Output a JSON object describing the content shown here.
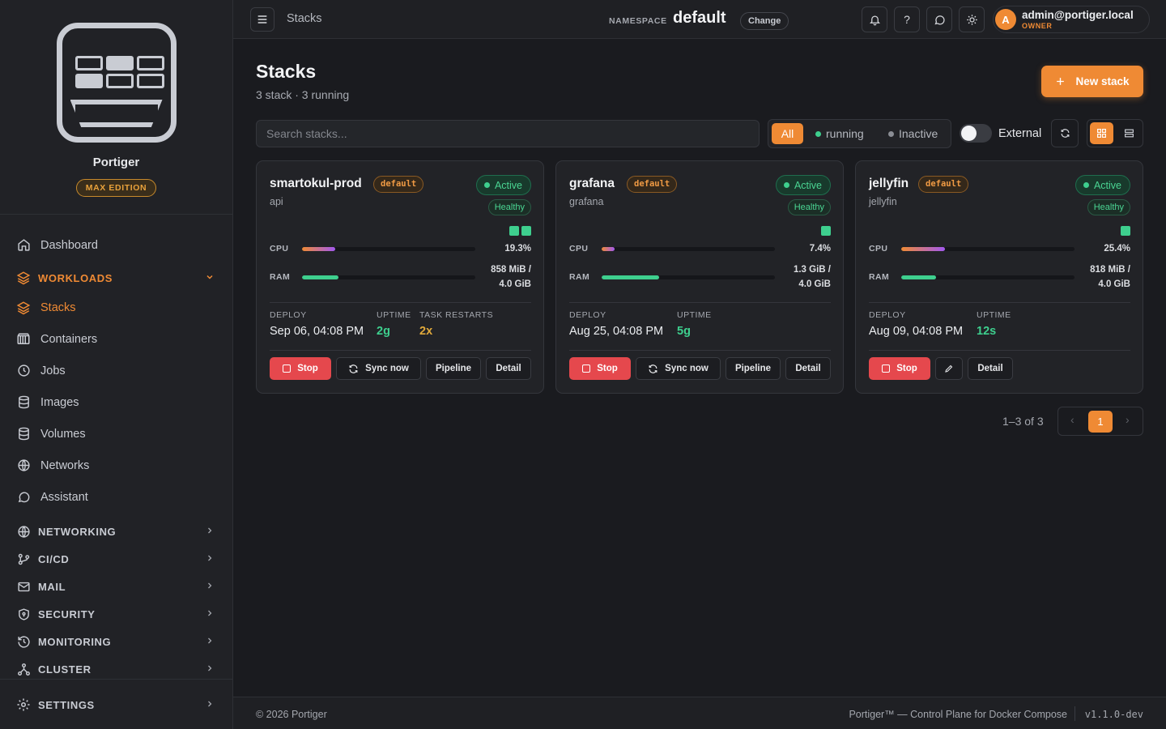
{
  "sidebar": {
    "brand_name": "Portiger",
    "edition": "MAX EDITION",
    "items_top": [
      {
        "label": "Dashboard",
        "icon": "home-icon"
      }
    ],
    "workloads_label": "WORKLOADS",
    "workloads_items": [
      {
        "label": "Stacks",
        "icon": "layers-icon",
        "active": true
      },
      {
        "label": "Containers",
        "icon": "container-icon"
      },
      {
        "label": "Jobs",
        "icon": "clock-icon"
      },
      {
        "label": "Images",
        "icon": "database-icon"
      },
      {
        "label": "Volumes",
        "icon": "database-icon"
      },
      {
        "label": "Networks",
        "icon": "globe-icon"
      },
      {
        "label": "Assistant",
        "icon": "chat-icon"
      }
    ],
    "groups": [
      {
        "label": "NETWORKING",
        "icon": "globe-icon"
      },
      {
        "label": "CI/CD",
        "icon": "git-icon"
      },
      {
        "label": "MAIL",
        "icon": "mail-icon"
      },
      {
        "label": "SECURITY",
        "icon": "shield-icon"
      },
      {
        "label": "MONITORING",
        "icon": "history-icon"
      },
      {
        "label": "CLUSTER",
        "icon": "cluster-icon"
      }
    ],
    "settings_label": "SETTINGS"
  },
  "topbar": {
    "breadcrumb": "Stacks",
    "namespace_label": "NAMESPACE",
    "namespace_value": "default",
    "namespace_change": "Change",
    "help_glyph": "?",
    "user_initial": "A",
    "user_email": "admin@portiger.local",
    "user_role": "OWNER"
  },
  "main": {
    "title": "Stacks",
    "subtitle": "3 stack · 3 running",
    "new_stack_label": "New stack",
    "search_placeholder": "Search stacks...",
    "filters": {
      "all": "All",
      "running": "running",
      "inactive": "Inactive"
    },
    "external_label": "External"
  },
  "labels": {
    "cpu": "CPU",
    "ram": "RAM",
    "deploy": "DEPLOY",
    "uptime": "UPTIME",
    "task_restarts": "TASK RESTARTS",
    "stop": "Stop",
    "sync": "Sync now",
    "pipeline": "Pipeline",
    "detail": "Detail"
  },
  "stacks": [
    {
      "name": "smartokul-prod",
      "namespace": "default",
      "service": "api",
      "status": "Active",
      "health": "Healthy",
      "tasks": 2,
      "cpu": "19.3%",
      "cpu_pct": 19.3,
      "ram_line1": "858 MiB /",
      "ram_line2": "4.0 GiB",
      "ram_pct": 21,
      "deploy": "Sep 06, 04:08 PM",
      "uptime": "2g",
      "restarts": "2x"
    },
    {
      "name": "grafana",
      "namespace": "default",
      "service": "grafana",
      "status": "Active",
      "health": "Healthy",
      "tasks": 1,
      "cpu": "7.4%",
      "cpu_pct": 7.4,
      "ram_line1": "1.3 GiB /",
      "ram_line2": "4.0 GiB",
      "ram_pct": 33,
      "deploy": "Aug 25, 04:08 PM",
      "uptime": "5g"
    },
    {
      "name": "jellyfin",
      "namespace": "default",
      "service": "jellyfin",
      "status": "Active",
      "health": "Healthy",
      "tasks": 1,
      "cpu": "25.4%",
      "cpu_pct": 25.4,
      "ram_line1": "818 MiB /",
      "ram_line2": "4.0 GiB",
      "ram_pct": 20,
      "deploy": "Aug 09, 04:08 PM",
      "uptime": "12s"
    }
  ],
  "pagination": {
    "range": "1–3 of 3",
    "current": "1",
    "prev": "‹",
    "next": "›"
  },
  "footer": {
    "copyright": "© 2026 Portiger",
    "tagline": "Portiger™ — Control Plane for Docker Compose",
    "version": "v1.1.0-dev"
  },
  "colors": {
    "accent": "#ef8a34",
    "success": "#3ecf8e",
    "danger": "#e5484d"
  }
}
